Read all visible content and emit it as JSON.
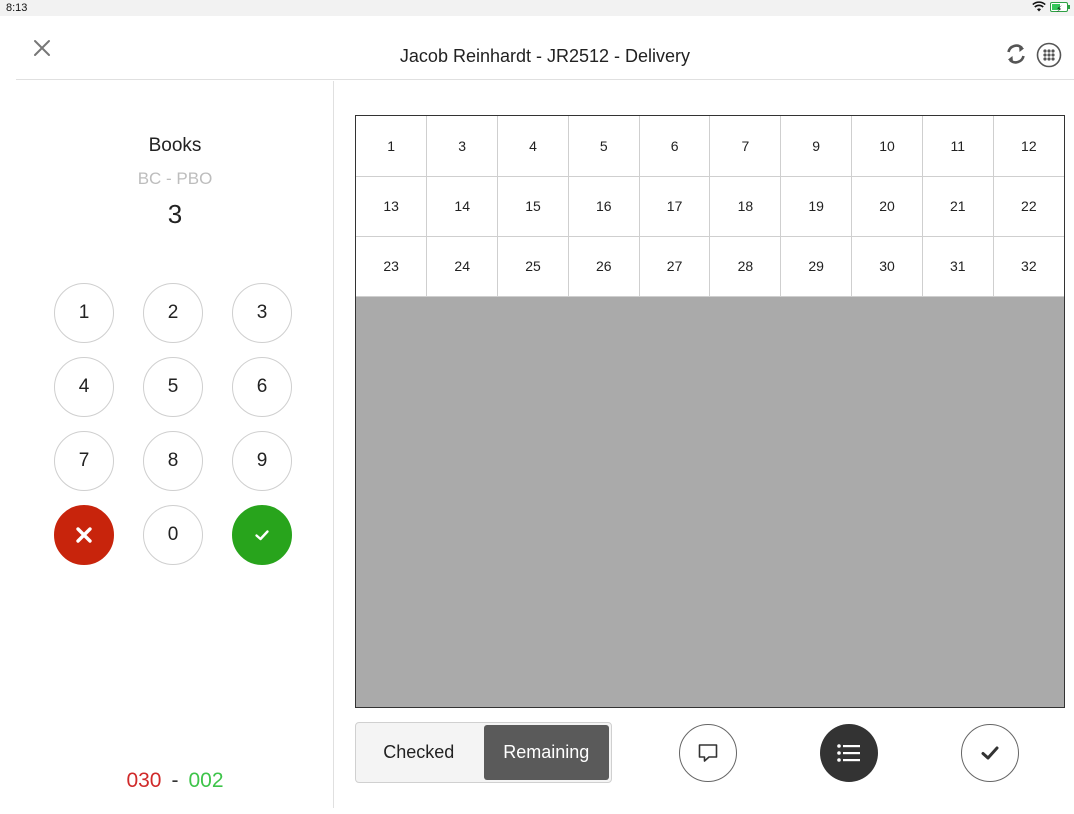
{
  "status_bar": {
    "time": "8:13",
    "battery_level": 0.6
  },
  "header": {
    "title": "Jacob Reinhardt - JR2512 - Delivery",
    "close_icon": "close-icon",
    "refresh_icon": "refresh-icon",
    "grid_icon": "grid-menu-icon"
  },
  "item": {
    "name": "Books",
    "code": "BC - PBO",
    "quantity": "3"
  },
  "keypad": {
    "keys": [
      "1",
      "2",
      "3",
      "4",
      "5",
      "6",
      "7",
      "8",
      "9",
      "0"
    ],
    "cancel_icon": "x-icon",
    "confirm_icon": "check-icon",
    "cancel_color": "#c8240c",
    "confirm_color": "#28a41c"
  },
  "counts": {
    "checked": "030",
    "separator": "-",
    "remaining": "002"
  },
  "grid": {
    "rows": [
      [
        "1",
        "3",
        "4",
        "5",
        "6",
        "7",
        "9",
        "10",
        "11",
        "12"
      ],
      [
        "13",
        "14",
        "15",
        "16",
        "17",
        "18",
        "19",
        "20",
        "21",
        "22"
      ],
      [
        "23",
        "24",
        "25",
        "26",
        "27",
        "28",
        "29",
        "30",
        "31",
        "32"
      ]
    ]
  },
  "toggle": {
    "checked_label": "Checked",
    "remaining_label": "Remaining",
    "selected": "Remaining"
  },
  "actions": {
    "comment_icon": "comment-icon",
    "list_icon": "list-icon",
    "complete_icon": "check-icon"
  }
}
